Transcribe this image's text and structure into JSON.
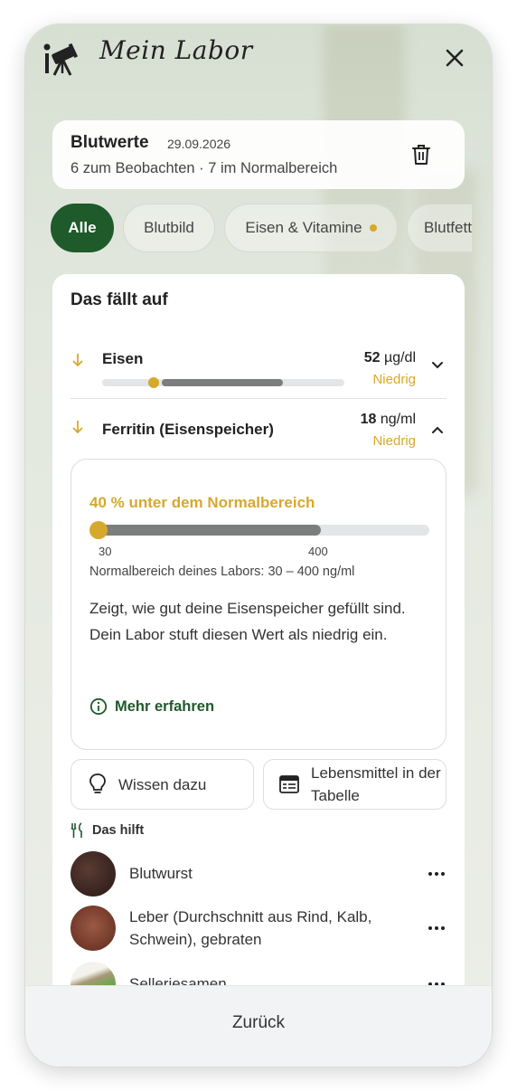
{
  "app": {
    "title": "Mein Labor",
    "logo_icon": "telescope-icon",
    "close_icon": "close-icon"
  },
  "summary": {
    "title": "Blutwerte",
    "date": "29.09.2026",
    "subtitle": "6 zum Beobachten · 7 im Normalbereich",
    "delete_icon": "trash-icon"
  },
  "filters": {
    "chips": [
      {
        "label": "Alle",
        "active": true
      },
      {
        "label": "Blutbild",
        "active": false
      },
      {
        "label": "Eisen & Vitamine",
        "active": false,
        "has_dot": true
      },
      {
        "label": "Blutfett",
        "active": false
      }
    ]
  },
  "highlights": {
    "title": "Das fällt auf",
    "items": [
      {
        "name": "Eisen",
        "value": "52",
        "unit": "µg/dl",
        "status": "Niedrig",
        "expanded": false
      },
      {
        "name": "Ferritin (Eisenspeicher)",
        "value": "18",
        "unit": "ng/ml",
        "status": "Niedrig",
        "expanded": true,
        "detail": {
          "headline": "40 % unter dem Normalbereich",
          "range_low": "30",
          "range_high": "400",
          "range_note": "Normalbereich deines Labors: 30 – 400 ng/ml",
          "description": "Zeigt, wie gut deine Eisenspeicher gefüllt sind. Dein Labor stuft diesen Wert als niedrig ein.",
          "learn_more": "Mehr erfahren"
        }
      }
    ]
  },
  "actions": {
    "knowledge": "Wissen dazu",
    "food_table": "Lebensmittel in der Tabelle"
  },
  "helps": {
    "title": "Das hilft",
    "foods": [
      {
        "name": "Blutwurst"
      },
      {
        "name": "Leber (Durchschnitt aus Rind, Kalb, Schwein), gebraten"
      },
      {
        "name": "Selleriesamen"
      }
    ]
  },
  "footer": {
    "back": "Zurück"
  },
  "colors": {
    "accent_green": "#1f5a2b",
    "warning_gold": "#d6a92c"
  }
}
